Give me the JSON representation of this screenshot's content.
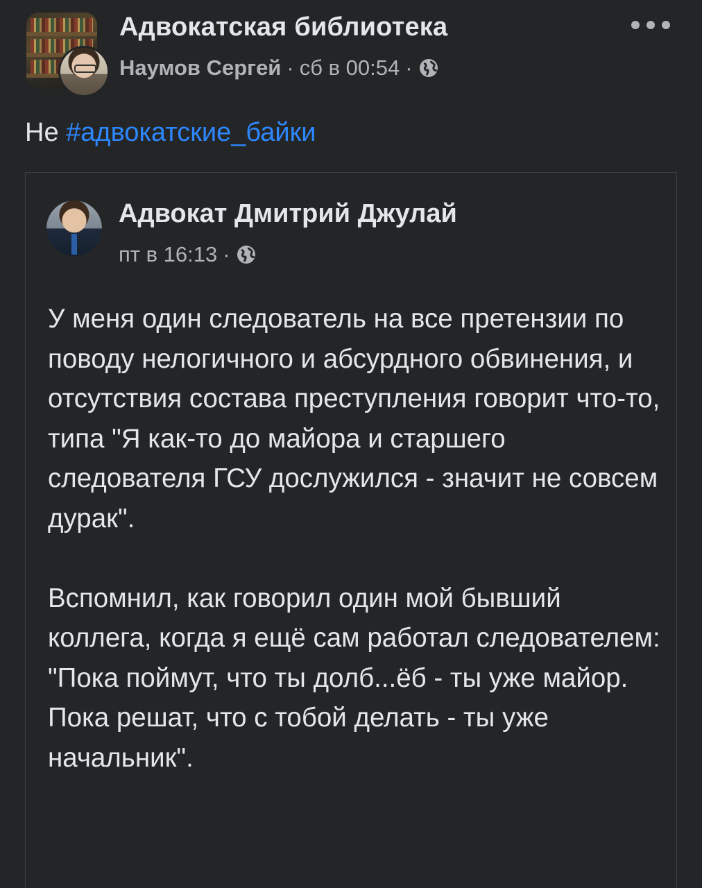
{
  "header": {
    "group_name": "Адвокатская библиотека",
    "author_name": "Наумов Сергей",
    "separator": "·",
    "timestamp": "сб в 00:54",
    "privacy_icon": "globe-icon",
    "more_icon": "more-horizontal-icon"
  },
  "post": {
    "text_prefix": "Не",
    "hashtag": "#адвокатские_байки"
  },
  "shared_post": {
    "author_name": "Адвокат Дмитрий Джулай",
    "timestamp": "пт в 16:13",
    "separator": "·",
    "privacy_icon": "globe-icon",
    "paragraphs": [
      "У меня один следователь на все претензии по поводу нелогичного и абсурдного обвинения, и отсутствия состава преступления говорит что-то, типа \"Я как-то до майора и старшего следователя ГСУ дослужился - значит не совсем дурак\".",
      "Вспомнил, как говорил один мой бывший коллега, когда я ещё сам работал следователем: \"Пока поймут, что ты долб...ёб - ты уже майор. Пока решат, что с тобой делать - ты уже начальник\"."
    ]
  },
  "colors": {
    "background": "#242526",
    "primary_text": "#e4e6eb",
    "secondary_text": "#b0b3b8",
    "link": "#2d88ff",
    "border": "#3e4042"
  }
}
